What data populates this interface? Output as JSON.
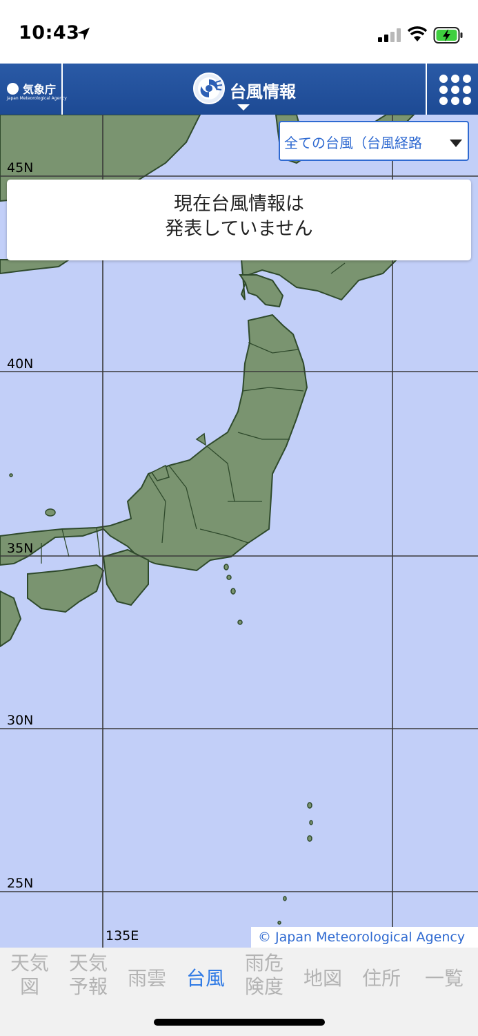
{
  "status_bar": {
    "time": "10:43"
  },
  "header": {
    "logo_text": "気象庁",
    "logo_subtext": "Japan Meteorological Agency",
    "title": "台風情報"
  },
  "map": {
    "filter_select": {
      "selected": "全ての台風（台風経路"
    },
    "notice": {
      "line1": "現在台風情報は",
      "line2": "発表していません"
    },
    "latitude_labels": [
      "45N",
      "40N",
      "35N",
      "30N",
      "25N"
    ],
    "longitude_label": "135E",
    "copyright": "© Japan Meteorological Agency",
    "colors": {
      "sea": "#c2cff8",
      "land": "#7a9470",
      "border": "#2f4a2c",
      "grid": "#3a3a3a"
    }
  },
  "tabs": [
    {
      "line1": "天気",
      "line2": "図",
      "active": false
    },
    {
      "line1": "天気",
      "line2": "予報",
      "active": false
    },
    {
      "line1": "雨雲",
      "line2": "",
      "active": false
    },
    {
      "line1": "台風",
      "line2": "",
      "active": true
    },
    {
      "line1": "雨危",
      "line2": "険度",
      "active": false
    },
    {
      "line1": "地図",
      "line2": "",
      "active": false
    },
    {
      "line1": "住所",
      "line2": "",
      "active": false
    },
    {
      "line1": "一覧",
      "line2": "",
      "active": false
    }
  ],
  "colors": {
    "header_blue": "#1d4a94",
    "accent": "#2f7ae5",
    "tab_inactive": "#b3b3b3"
  }
}
